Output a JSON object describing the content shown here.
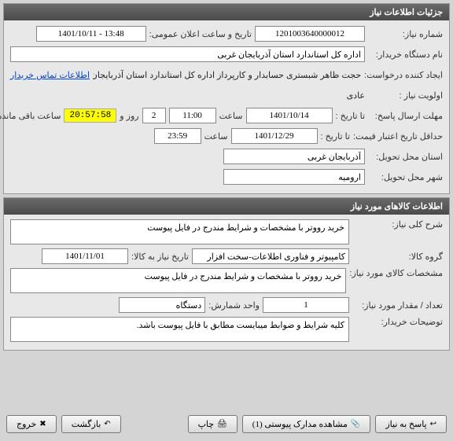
{
  "panel1": {
    "title": "جزئیات اطلاعات نیاز",
    "need_number_label": "شماره نیاز:",
    "need_number": "1201003640000012",
    "announce_label": "تاریخ و ساعت اعلان عمومی:",
    "announce_value": "1401/10/11 - 13:48",
    "buyer_label": "نام دستگاه خریدار:",
    "buyer_value": "اداره کل استاندارد استان آذربایجان غربی",
    "creator_label": "ایجاد کننده درخواست:",
    "creator_value": "حجت ظاهر شبستری حسابدار و کارپرداز اداره کل استاندارد استان آذربایجان غربی",
    "buyer_contact_link": "اطلاعات تماس خریدار",
    "priority_label": "اولویت نیاز :",
    "priority_value": "عادی",
    "deadline_label": "مهلت ارسال پاسخ:",
    "to_date_label": "تا تاریخ :",
    "deadline_date": "1401/10/14",
    "time_label": "ساعت",
    "deadline_time": "11:00",
    "days_remaining": "2",
    "days_and_label": "روز و",
    "time_remaining": "20:57:58",
    "remaining_label": "ساعت باقی مانده",
    "validity_label": "حداقل تاریخ اعتبار قیمت:",
    "validity_date": "1401/12/29",
    "validity_time": "23:59",
    "province_label": "استان محل تحویل:",
    "province_value": "آذربایجان غربی",
    "city_label": "شهر محل تحویل:",
    "city_value": "ارومیه"
  },
  "panel2": {
    "title": "اطلاعات کالاهای مورد نیاز",
    "desc_label": "شرح کلی نیاز:",
    "desc_value": "خرید رووتر با مشخصات و شرایط مندرج در فایل پیوست",
    "group_label": "گروه کالا:",
    "group_value": "کامپیوتر و فناوری اطلاعات-سخت افزار",
    "need_date_label": "تاریخ نیاز به کالا:",
    "need_date_value": "1401/11/01",
    "spec_label": "مشخصات کالای مورد نیاز:",
    "spec_value": "خرید رووتر با مشخصات و شرایط مندرج در فایل پیوست",
    "qty_label": "تعداد / مقدار مورد نیاز:",
    "qty_value": "1",
    "unit_label": "واحد شمارش:",
    "unit_value": "دستگاه",
    "notes_label": "توضیحات خریدار:",
    "notes_value": "کلیه شرایط و ضوابط میبایست مطابق با فایل پیوست باشد."
  },
  "footer": {
    "respond": "پاسخ به نیاز",
    "attachments": "مشاهده مدارک پیوستی (1)",
    "print": "چاپ",
    "back": "بازگشت",
    "exit": "خروج"
  }
}
